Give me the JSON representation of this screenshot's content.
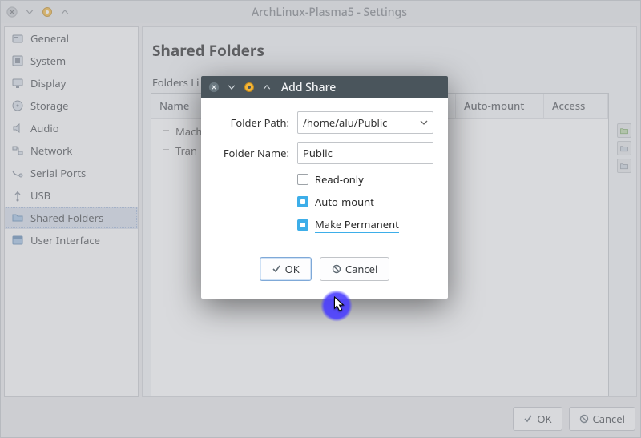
{
  "window": {
    "title": "ArchLinux-Plasma5 - Settings",
    "sidebar": {
      "items": [
        {
          "label": "General",
          "icon": "general-icon"
        },
        {
          "label": "System",
          "icon": "system-icon"
        },
        {
          "label": "Display",
          "icon": "display-icon"
        },
        {
          "label": "Storage",
          "icon": "storage-icon"
        },
        {
          "label": "Audio",
          "icon": "audio-icon"
        },
        {
          "label": "Network",
          "icon": "network-icon"
        },
        {
          "label": "Serial Ports",
          "icon": "serial-icon"
        },
        {
          "label": "USB",
          "icon": "usb-icon"
        },
        {
          "label": "Shared Folders",
          "icon": "folder-icon",
          "selected": true
        },
        {
          "label": "User Interface",
          "icon": "ui-icon"
        }
      ]
    },
    "main": {
      "heading": "Shared Folders",
      "list_label": "Folders Li",
      "columns": [
        "Name",
        "Auto-mount",
        "Access"
      ],
      "tree": [
        "Mach",
        "Tran"
      ]
    },
    "footer": {
      "ok": "OK",
      "cancel": "Cancel"
    }
  },
  "dialog": {
    "title": "Add Share",
    "folder_path_label": "Folder Path:",
    "folder_path_value": "/home/alu/Public",
    "folder_name_label": "Folder Name:",
    "folder_name_value": "Public",
    "checks": {
      "read_only": {
        "label": "Read-only",
        "checked": false
      },
      "auto_mount": {
        "label": "Auto-mount",
        "checked": true
      },
      "make_permanent": {
        "label": "Make Permanent",
        "checked": true
      }
    },
    "buttons": {
      "ok": "OK",
      "cancel": "Cancel"
    }
  }
}
